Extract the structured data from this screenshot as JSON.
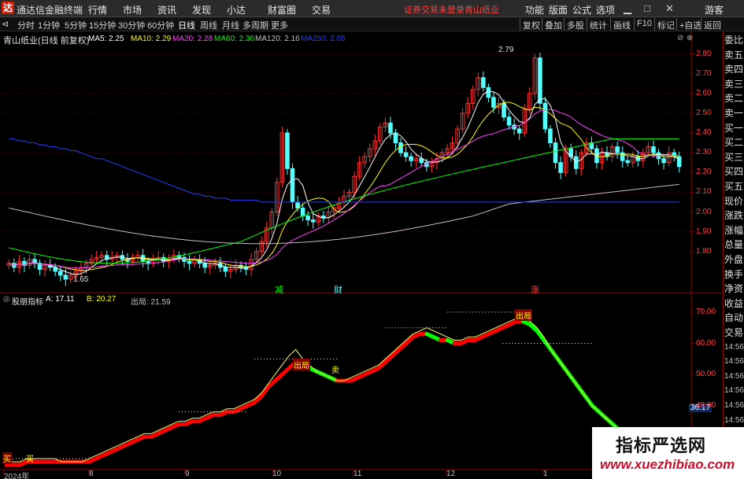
{
  "app": {
    "title": "通达信金融终端",
    "menus": [
      "行情",
      "市场",
      "资讯",
      "发现",
      "小达",
      "财富圈",
      "交易"
    ],
    "notice": "证券交易未登录",
    "stock_name_top": "青山纸业",
    "right_menus": [
      "功能",
      "版面",
      "公式",
      "选项"
    ],
    "guest": "游客"
  },
  "periods": {
    "tabs": [
      "分时",
      "1分钟",
      "5分钟",
      "15分钟",
      "30分钟",
      "60分钟",
      "日线",
      "周线",
      "月线",
      "多周期",
      "更多"
    ],
    "active": "日线",
    "right_buttons": [
      "复权",
      "叠加",
      "多股",
      "统计",
      "画线",
      "F10",
      "标记",
      "+自选",
      "返回"
    ]
  },
  "main_chart": {
    "legend_title": "青山纸业(日线 前复权)",
    "ma": [
      {
        "label": "MA5: 2.25",
        "color": "#ffffff"
      },
      {
        "label": "MA10: 2.29",
        "color": "#ffff00"
      },
      {
        "label": "MA20: 2.28",
        "color": "#ff40ff"
      },
      {
        "label": "MA60: 2.36",
        "color": "#00ff00"
      },
      {
        "label": "MA120: 2.16",
        "color": "#c0c0c0"
      },
      {
        "label": "MA250: 2.05",
        "color": "#2040ff"
      }
    ],
    "y_ticks": [
      "2.80",
      "2.70",
      "2.60",
      "2.50",
      "2.40",
      "2.30",
      "2.20",
      "2.10",
      "2.00",
      "1.90",
      "1.80"
    ],
    "high_label": "2.79",
    "low_label": "1.65",
    "markers": [
      "减",
      "财",
      "涨"
    ]
  },
  "indicator": {
    "legend_title": "股朋指标",
    "values": [
      {
        "label": "A: 17.11",
        "color": "#ffffff"
      },
      {
        "label": "B: 20.27",
        "color": "#ffff00"
      },
      {
        "label": "出局: 21.59",
        "color": "#c0c0c0"
      }
    ],
    "y_ticks": [
      "70.00",
      "60.00",
      "50.00",
      "40.00",
      "30.00"
    ],
    "crosshair_value": "36.17",
    "signal_buy": "买",
    "signal_sell": "卖",
    "signal_out": "出局"
  },
  "x_axis": [
    "2024年",
    "8",
    "9",
    "10",
    "11",
    "12",
    "1"
  ],
  "right_panel": [
    "委比",
    "卖五",
    "卖四",
    "卖三",
    "卖二",
    "卖一",
    "买一",
    "买二",
    "买三",
    "买四",
    "买五",
    "现价",
    "涨跌",
    "涨幅",
    "总量",
    "外盘",
    "换手",
    "净资",
    "收益",
    "自动",
    "交易",
    "14:56",
    "14:56",
    "14:56",
    "14:56",
    "14:56",
    "14:56",
    "14:56",
    "14:56",
    "14:56"
  ],
  "watermark": {
    "line1": "指标严选网",
    "line2": "www.xuezhibiao.com"
  },
  "colors": {
    "up": "#ff3030",
    "down": "#54ffff",
    "red_curve": "#ff0000",
    "green_curve": "#00ff00",
    "grid": "#8b0000"
  },
  "chart_data": {
    "type": "candlestick",
    "main_price_range": [
      1.6,
      2.85
    ],
    "indicator_range": [
      20,
      73
    ],
    "close": [
      1.74,
      1.72,
      1.75,
      1.73,
      1.76,
      1.74,
      1.71,
      1.73,
      1.72,
      1.7,
      1.68,
      1.66,
      1.68,
      1.7,
      1.72,
      1.74,
      1.76,
      1.77,
      1.78,
      1.76,
      1.77,
      1.78,
      1.76,
      1.75,
      1.77,
      1.78,
      1.75,
      1.74,
      1.76,
      1.77,
      1.75,
      1.76,
      1.78,
      1.77,
      1.75,
      1.74,
      1.76,
      1.74,
      1.72,
      1.73,
      1.74,
      1.72,
      1.7,
      1.71,
      1.73,
      1.72,
      1.71,
      1.76,
      1.8,
      1.85,
      1.92,
      2.0,
      2.15,
      2.4,
      2.22,
      2.05,
      2.02,
      1.98,
      1.96,
      1.95,
      1.98,
      1.97,
      2.0,
      2.02,
      2.05,
      2.08,
      2.1,
      2.18,
      2.25,
      2.28,
      2.32,
      2.36,
      2.43,
      2.45,
      2.4,
      2.35,
      2.3,
      2.28,
      2.26,
      2.27,
      2.25,
      2.23,
      2.25,
      2.27,
      2.3,
      2.32,
      2.35,
      2.42,
      2.5,
      2.55,
      2.62,
      2.68,
      2.63,
      2.58,
      2.53,
      2.55,
      2.48,
      2.44,
      2.42,
      2.4,
      2.52,
      2.6,
      2.78,
      2.55,
      2.42,
      2.35,
      2.25,
      2.2,
      2.32,
      2.28,
      2.22,
      2.3,
      2.35,
      2.32,
      2.25,
      2.3,
      2.28,
      2.33,
      2.3,
      2.26,
      2.25,
      2.28,
      2.26,
      2.3,
      2.33,
      2.3,
      2.27,
      2.25,
      2.3,
      2.28,
      2.23
    ],
    "ma250": [
      2.37,
      2.37,
      2.36,
      2.36,
      2.35,
      2.35,
      2.34,
      2.34,
      2.33,
      2.33,
      2.32,
      2.32,
      2.31,
      2.31,
      2.3,
      2.29,
      2.28,
      2.27,
      2.27,
      2.26,
      2.25,
      2.24,
      2.23,
      2.22,
      2.21,
      2.2,
      2.19,
      2.18,
      2.17,
      2.16,
      2.15,
      2.14,
      2.13,
      2.12,
      2.11,
      2.1,
      2.09,
      2.09,
      2.08,
      2.08,
      2.07,
      2.07,
      2.07,
      2.06,
      2.06,
      2.06,
      2.06,
      2.06,
      2.06,
      2.05,
      2.05,
      2.05,
      2.05,
      2.05,
      2.05,
      2.05,
      2.05,
      2.05,
      2.05,
      2.05,
      2.05,
      2.05,
      2.05,
      2.05,
      2.05,
      2.05,
      2.05,
      2.05,
      2.05,
      2.05,
      2.05,
      2.05,
      2.05,
      2.05,
      2.05,
      2.05,
      2.05,
      2.05,
      2.05,
      2.05,
      2.05,
      2.05,
      2.05,
      2.05,
      2.05,
      2.05,
      2.05,
      2.05,
      2.05,
      2.05,
      2.05,
      2.05,
      2.05,
      2.05,
      2.05,
      2.05,
      2.05,
      2.05,
      2.05,
      2.05,
      2.05,
      2.05,
      2.05,
      2.05,
      2.05,
      2.05,
      2.05,
      2.05,
      2.05,
      2.05,
      2.05,
      2.05,
      2.05,
      2.05,
      2.05,
      2.05,
      2.05,
      2.05,
      2.05,
      2.05,
      2.05,
      2.05,
      2.05,
      2.05,
      2.05,
      2.05,
      2.05,
      2.05,
      2.05,
      2.05,
      2.05
    ],
    "indicator_A": [
      22,
      22,
      22,
      23,
      23,
      23,
      23,
      23,
      22,
      22,
      22,
      22,
      23,
      24,
      25,
      26,
      27,
      28,
      29,
      30,
      31,
      31,
      32,
      33,
      34,
      35,
      35,
      36,
      36,
      37,
      38,
      38,
      39,
      39,
      40,
      41,
      42,
      44,
      47,
      50,
      53,
      56,
      58,
      55,
      53,
      51,
      50,
      49,
      48,
      48,
      49,
      50,
      51,
      52,
      53,
      55,
      57,
      59,
      61,
      63,
      64,
      65,
      64,
      63,
      62,
      61,
      61,
      62,
      62,
      63,
      64,
      65,
      66,
      67,
      68,
      68,
      67,
      65,
      62,
      58,
      55,
      52,
      49,
      46,
      43,
      40,
      38,
      36,
      34,
      32,
      31,
      30,
      29,
      28,
      27,
      26,
      25,
      24
    ],
    "indicator_B": [
      21,
      21,
      21,
      22,
      22,
      22,
      22,
      22,
      22,
      22,
      22,
      22,
      22,
      23,
      24,
      25,
      26,
      27,
      28,
      29,
      30,
      30,
      31,
      32,
      33,
      34,
      34,
      35,
      35,
      36,
      37,
      37,
      38,
      38,
      39,
      40,
      41,
      43,
      46,
      48,
      50,
      52,
      54,
      53,
      52,
      51,
      50,
      49,
      48,
      48,
      48,
      49,
      50,
      51,
      52,
      54,
      56,
      58,
      60,
      62,
      63,
      63,
      62,
      61,
      61,
      60,
      60,
      61,
      61,
      62,
      63,
      64,
      65,
      66,
      67,
      67,
      66,
      64,
      61,
      58,
      55,
      52,
      49,
      46,
      43,
      40,
      38,
      36,
      34,
      32,
      31,
      30,
      29,
      28,
      27,
      26,
      25,
      24
    ]
  }
}
